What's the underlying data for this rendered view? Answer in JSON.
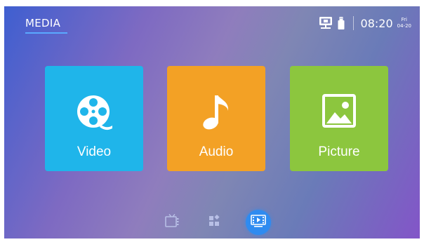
{
  "header": {
    "tab_label": "MEDIA"
  },
  "status_bar": {
    "network_icon": "network-icon",
    "usb_icon": "usb-icon",
    "time": "08:20",
    "day": "Fri",
    "date": "04-20"
  },
  "tiles": [
    {
      "label": "Video",
      "icon": "film-reel-icon",
      "color": "#1fb5ea"
    },
    {
      "label": "Audio",
      "icon": "music-note-icon",
      "color": "#f3a125"
    },
    {
      "label": "Picture",
      "icon": "image-icon",
      "color": "#8cc63e"
    }
  ],
  "bottom_nav": {
    "items": [
      {
        "icon": "tv-icon",
        "selected": false
      },
      {
        "icon": "apps-icon",
        "selected": false
      },
      {
        "icon": "media-icon",
        "selected": true
      }
    ],
    "accent_color": "#2f8bf0"
  }
}
